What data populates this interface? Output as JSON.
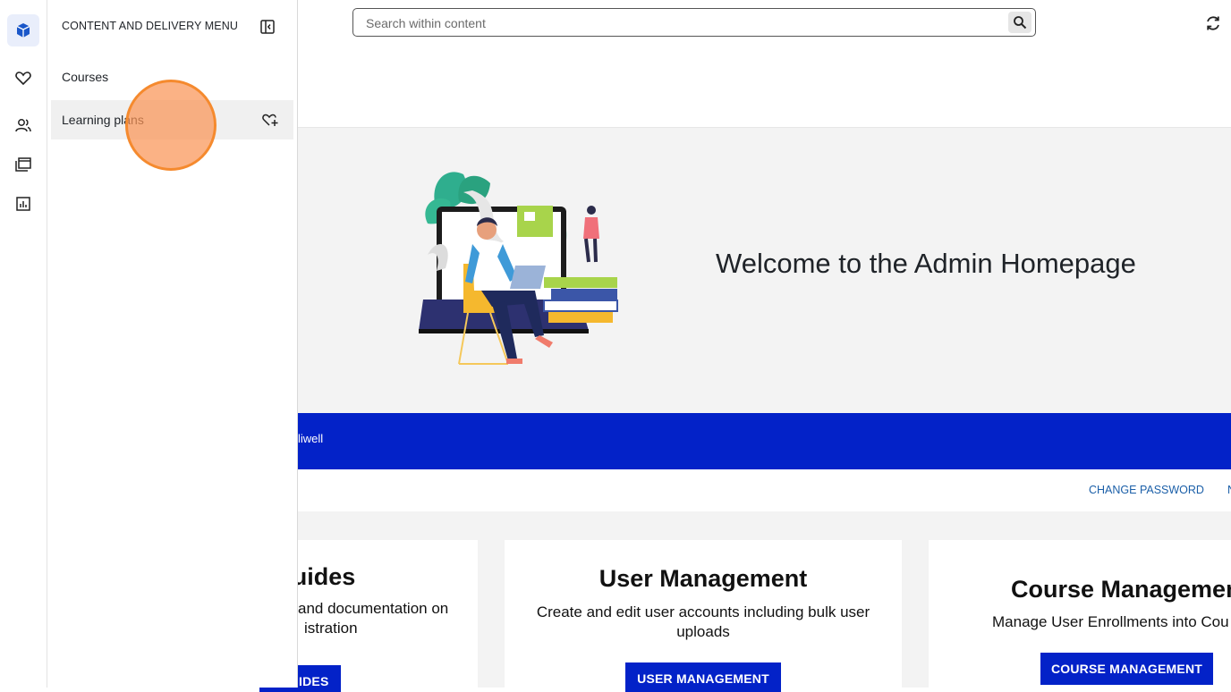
{
  "rail": {
    "items": [
      {
        "name": "content-cube-icon",
        "active": true
      },
      {
        "name": "heart-icon",
        "active": false
      },
      {
        "name": "users-icon",
        "active": false
      },
      {
        "name": "folders-icon",
        "active": false
      },
      {
        "name": "reports-chart-icon",
        "active": false
      }
    ]
  },
  "flyout": {
    "title": "CONTENT AND DELIVERY MENU",
    "collapse_icon": "panel-collapse-icon",
    "items": [
      {
        "label": "Courses"
      },
      {
        "label": "Learning plans",
        "action_icon": "heart-plus-icon"
      }
    ]
  },
  "search": {
    "placeholder": "Search within content",
    "value": "",
    "button_icon": "search-icon"
  },
  "topbar": {
    "refresh_icon": "refresh-icon"
  },
  "hero": {
    "title": "Welcome to the Admin Homepage"
  },
  "banner": {
    "text": "liwell"
  },
  "links": {
    "change_password": "CHANGE PASSWORD",
    "partial_next": "N"
  },
  "cards": {
    "guides": {
      "title": "uides",
      "desc_line1": "and documentation on",
      "desc_line2": "istration",
      "button": "IDES"
    },
    "user_management": {
      "title": "User Management",
      "desc": "Create and edit user accounts including bulk user uploads",
      "button": "USER MANAGEMENT"
    },
    "course_management": {
      "title": "Course Managemen",
      "desc": "Manage User Enrollments into Cou",
      "button": "COURSE MANAGEMENT"
    }
  },
  "colors": {
    "brand_blue": "#0322c8",
    "link_blue": "#1b5fa8",
    "click_marker": "#f58a2e",
    "hero_bg": "#f3f3f3"
  }
}
